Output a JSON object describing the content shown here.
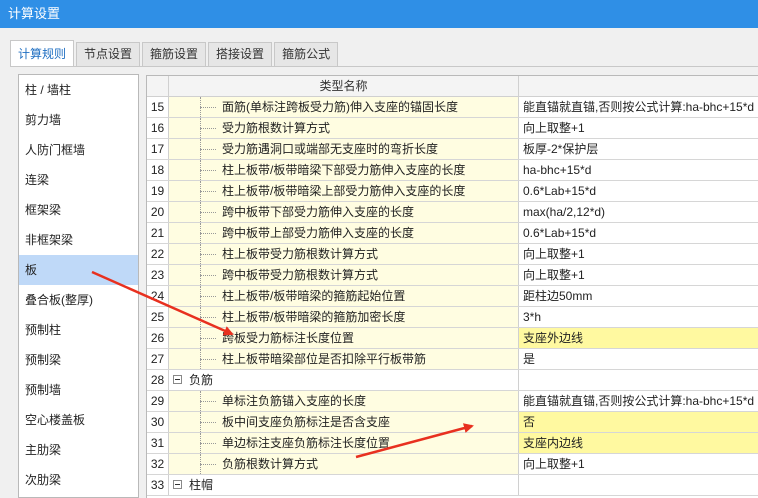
{
  "window": {
    "title": "计算设置"
  },
  "tabs": [
    {
      "label": "计算规则",
      "active": true
    },
    {
      "label": "节点设置",
      "active": false
    },
    {
      "label": "箍筋设置",
      "active": false
    },
    {
      "label": "搭接设置",
      "active": false
    },
    {
      "label": "箍筋公式",
      "active": false
    }
  ],
  "sidebar": {
    "items": [
      {
        "label": "柱 / 墙柱",
        "selected": false
      },
      {
        "label": "剪力墙",
        "selected": false
      },
      {
        "label": "人防门框墙",
        "selected": false
      },
      {
        "label": "连梁",
        "selected": false
      },
      {
        "label": "框架梁",
        "selected": false
      },
      {
        "label": "非框架梁",
        "selected": false
      },
      {
        "label": "板",
        "selected": true
      },
      {
        "label": "叠合板(整厚)",
        "selected": false
      },
      {
        "label": "预制柱",
        "selected": false
      },
      {
        "label": "预制梁",
        "selected": false
      },
      {
        "label": "预制墙",
        "selected": false
      },
      {
        "label": "空心楼盖板",
        "selected": false
      },
      {
        "label": "主肋梁",
        "selected": false
      },
      {
        "label": "次肋梁",
        "selected": false
      }
    ]
  },
  "grid": {
    "header": {
      "name": "类型名称"
    },
    "rows": [
      {
        "num": "15",
        "name": "面筋(单标注跨板受力筋)伸入支座的锚固长度",
        "value": "能直锚就直锚,否则按公式计算:ha-bhc+15*d",
        "kind": "child",
        "highlight": false
      },
      {
        "num": "16",
        "name": "受力筋根数计算方式",
        "value": "向上取整+1",
        "kind": "child",
        "highlight": false
      },
      {
        "num": "17",
        "name": "受力筋遇洞口或端部无支座时的弯折长度",
        "value": "板厚-2*保护层",
        "kind": "child",
        "highlight": false
      },
      {
        "num": "18",
        "name": "柱上板带/板带暗梁下部受力筋伸入支座的长度",
        "value": "ha-bhc+15*d",
        "kind": "child",
        "highlight": false
      },
      {
        "num": "19",
        "name": "柱上板带/板带暗梁上部受力筋伸入支座的长度",
        "value": "0.6*Lab+15*d",
        "kind": "child",
        "highlight": false
      },
      {
        "num": "20",
        "name": "跨中板带下部受力筋伸入支座的长度",
        "value": "max(ha/2,12*d)",
        "kind": "child",
        "highlight": false
      },
      {
        "num": "21",
        "name": "跨中板带上部受力筋伸入支座的长度",
        "value": "0.6*Lab+15*d",
        "kind": "child",
        "highlight": false
      },
      {
        "num": "22",
        "name": "柱上板带受力筋根数计算方式",
        "value": "向上取整+1",
        "kind": "child",
        "highlight": false
      },
      {
        "num": "23",
        "name": "跨中板带受力筋根数计算方式",
        "value": "向上取整+1",
        "kind": "child",
        "highlight": false
      },
      {
        "num": "24",
        "name": "柱上板带/板带暗梁的箍筋起始位置",
        "value": "距柱边50mm",
        "kind": "child",
        "highlight": false
      },
      {
        "num": "25",
        "name": "柱上板带/板带暗梁的箍筋加密长度",
        "value": "3*h",
        "kind": "child",
        "highlight": false
      },
      {
        "num": "26",
        "name": "跨板受力筋标注长度位置",
        "value": "支座外边线",
        "kind": "child",
        "highlight": true
      },
      {
        "num": "27",
        "name": "柱上板带暗梁部位是否扣除平行板带筋",
        "value": "是",
        "kind": "child",
        "highlight": false
      },
      {
        "num": "28",
        "name": "负筋",
        "value": "",
        "kind": "group",
        "highlight": false
      },
      {
        "num": "29",
        "name": "单标注负筋锚入支座的长度",
        "value": "能直锚就直锚,否则按公式计算:ha-bhc+15*d",
        "kind": "child",
        "highlight": false
      },
      {
        "num": "30",
        "name": "板中间支座负筋标注是否含支座",
        "value": "否",
        "kind": "child",
        "highlight": true
      },
      {
        "num": "31",
        "name": "单边标注支座负筋标注长度位置",
        "value": "支座内边线",
        "kind": "child",
        "highlight": true
      },
      {
        "num": "32",
        "name": "负筋根数计算方式",
        "value": "向上取整+1",
        "kind": "child",
        "highlight": false
      },
      {
        "num": "33",
        "name": "柱帽",
        "value": "",
        "kind": "group",
        "highlight": false
      }
    ]
  },
  "colors": {
    "titlebar": "#2f8fe6",
    "highlight": "#fff9a0",
    "child_cell": "#fffde1",
    "selected_item": "#bfd9f8",
    "arrow": "#e8301f"
  }
}
